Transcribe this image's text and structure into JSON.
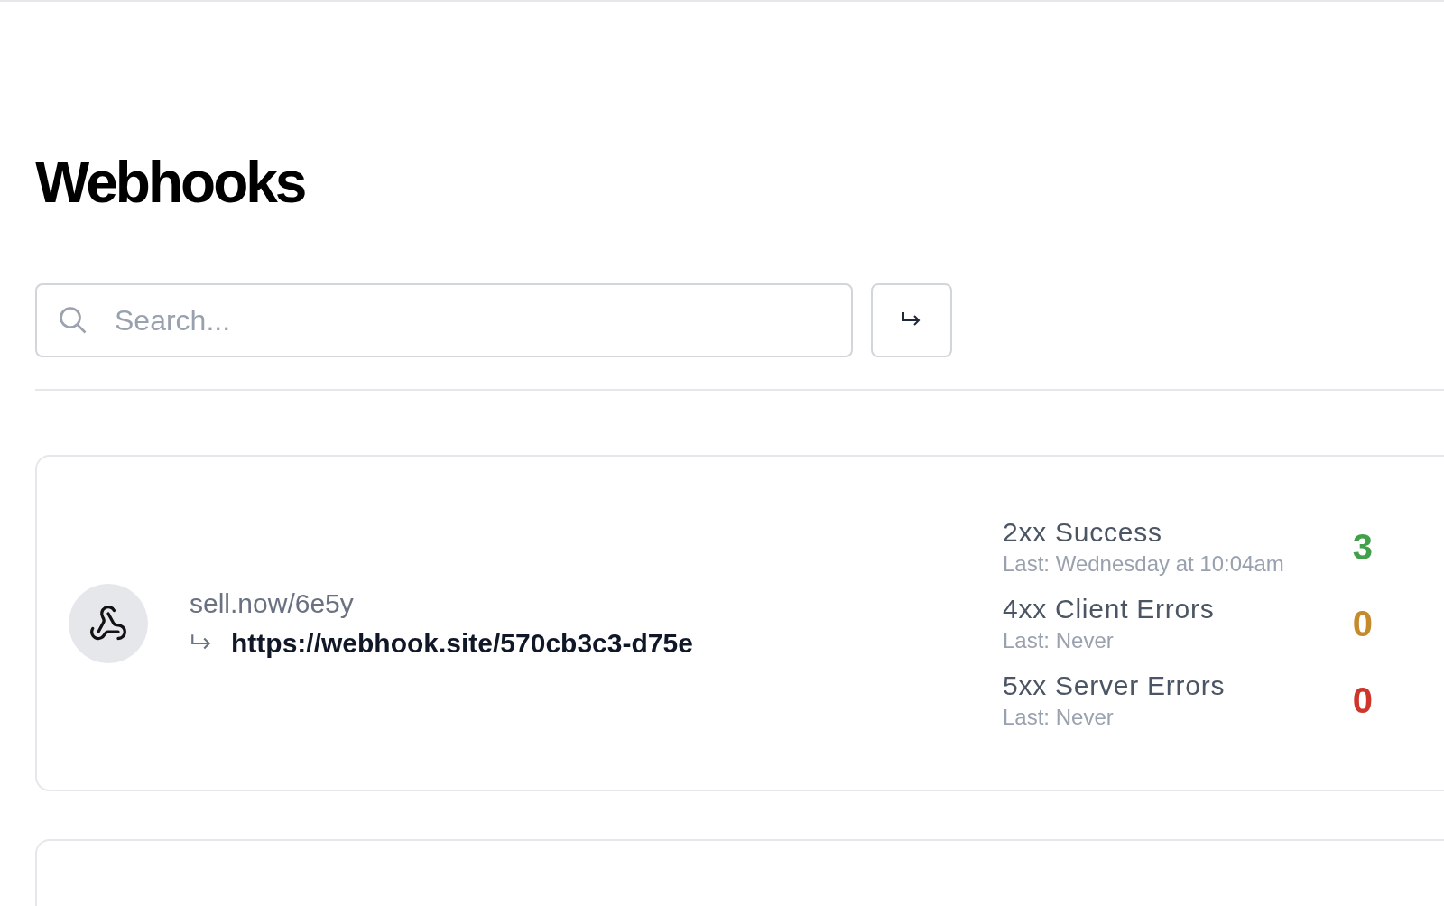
{
  "page_title": "Webhooks",
  "search": {
    "placeholder": "Search..."
  },
  "webhooks": [
    {
      "source": "sell.now/6e5y",
      "destination": "https://webhook.site/570cb3c3-d75e",
      "stats": [
        {
          "label": "2xx Success",
          "last": "Last: Wednesday at 10:04am",
          "count": "3",
          "color": "#43a04a"
        },
        {
          "label": "4xx Client Errors",
          "last": "Last: Never",
          "count": "0",
          "color": "#c48a2c"
        },
        {
          "label": "5xx Server Errors",
          "last": "Last: Never",
          "count": "0",
          "color": "#d0352b"
        }
      ]
    }
  ]
}
